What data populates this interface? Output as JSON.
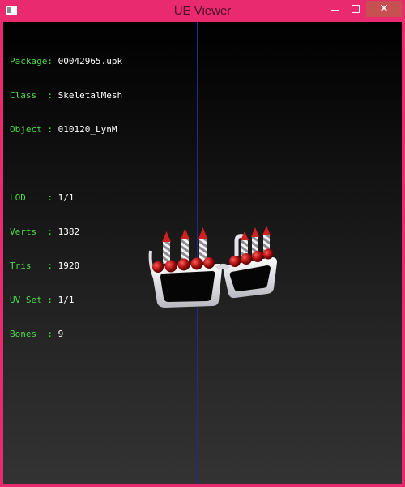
{
  "window": {
    "title": "UE Viewer",
    "controls": {
      "minimize_icon": "minimize-icon",
      "maximize_icon": "maximize-icon",
      "close_glyph": "✕"
    }
  },
  "info": {
    "package_key": "Package:",
    "package_value": "00042965.upk",
    "class_key": "Class  :",
    "class_value": "SkeletalMesh",
    "object_key": "Object :",
    "object_value": "010120_LynM",
    "lod_key": "LOD    :",
    "lod_value": "1/1",
    "verts_key": "Verts  :",
    "verts_value": "1382",
    "tris_key": "Tris   :",
    "tris_value": "1920",
    "uvset_key": "UV Set :",
    "uvset_value": "1/1",
    "bones_key": "Bones  :",
    "bones_value": "9"
  },
  "colors": {
    "frame": "#ea2a6e",
    "close_button": "#c75050",
    "label_green": "#4cd94c",
    "axis_blue": "#1e2a9a"
  }
}
